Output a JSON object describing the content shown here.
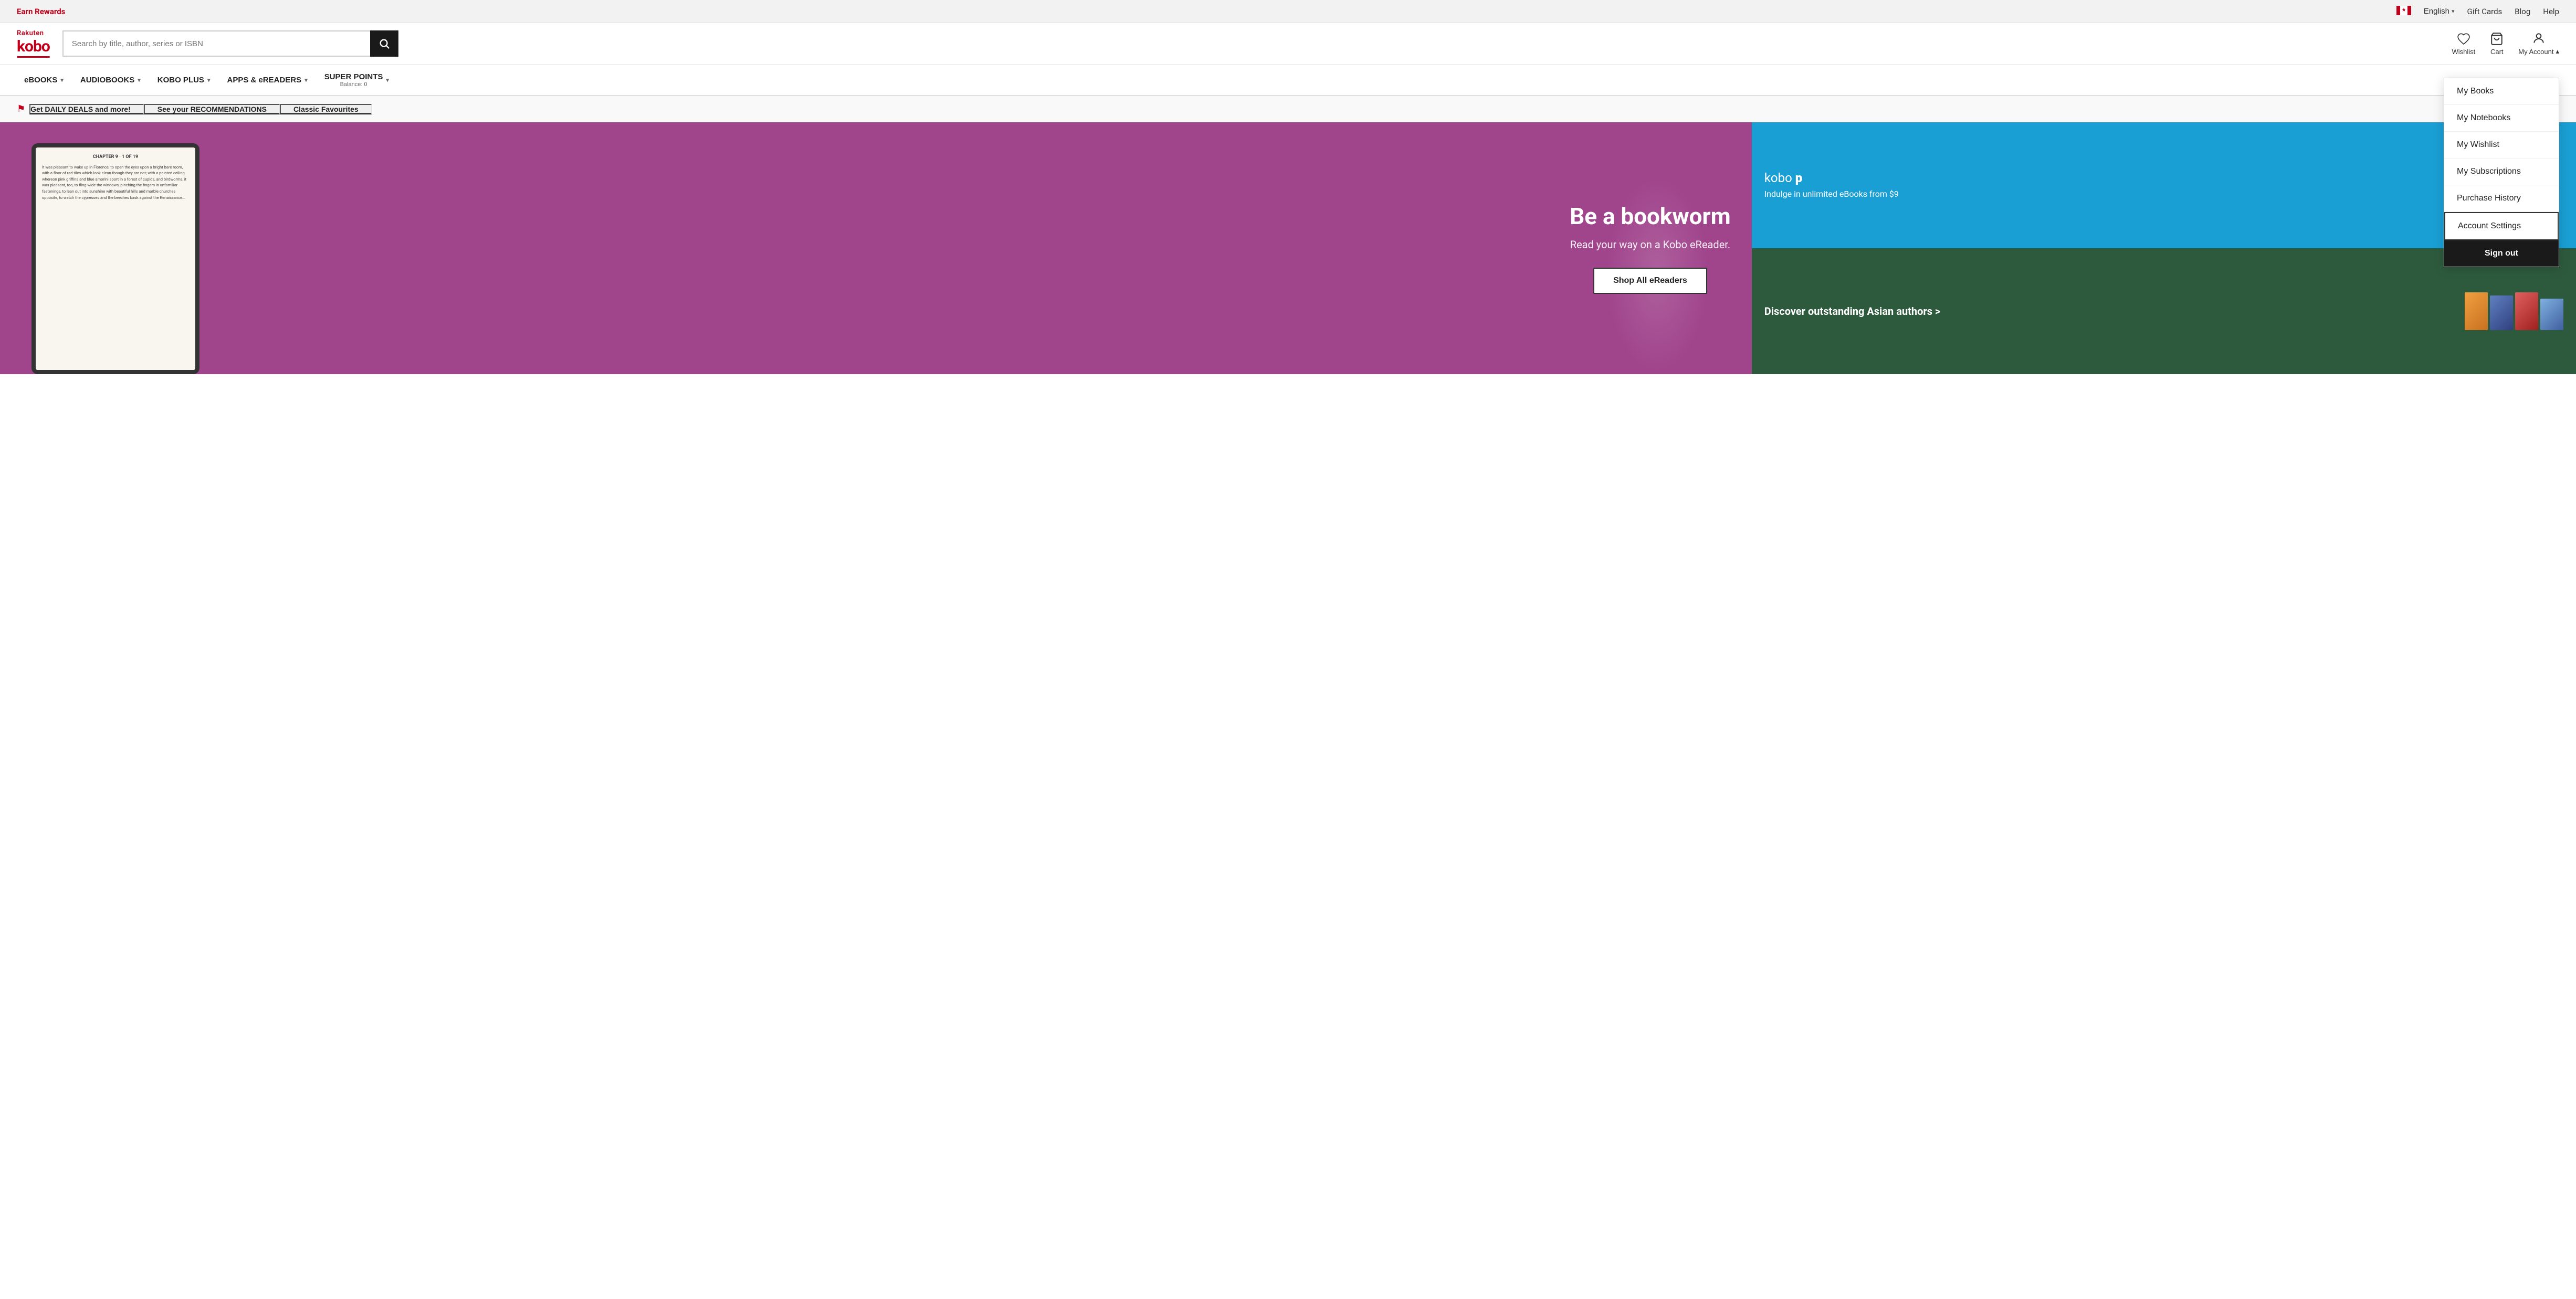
{
  "topbar": {
    "earn_rewards": "Earn Rewards",
    "language": "English",
    "gift_cards": "Gift Cards",
    "blog": "Blog",
    "help": "Help"
  },
  "header": {
    "logo_rakuten": "Rakuten",
    "logo_kobo": "kobo",
    "search_placeholder": "Search by title, author, series or ISBN",
    "wishlist_label": "Wishlist",
    "cart_label": "Cart",
    "my_account_label": "My Account"
  },
  "nav": {
    "items": [
      {
        "label": "eBOOKS",
        "has_chevron": true
      },
      {
        "label": "AUDIOBOOKS",
        "has_chevron": true
      },
      {
        "label": "KOBO PLUS",
        "has_chevron": true
      },
      {
        "label": "APPS & eREADERS",
        "has_chevron": true
      },
      {
        "label": "SUPER POINTS",
        "has_chevron": true
      }
    ],
    "balance": "Balance: 0"
  },
  "promobar": {
    "daily_deals": "Get DAILY DEALS and more!",
    "recommendations": "See your RECOMMENDATIONS",
    "classic": "Classic Favourites"
  },
  "hero": {
    "title": "Be a bookworm",
    "subtitle": "Read your way on a Kobo eReader.",
    "cta": "Shop All eReaders",
    "chapter_text": "CHAPTER 9 · 1 OF 19",
    "body_text": "It was pleasant to wake up in Florence, to open the eyes upon a bright bare room, with a floor of red tiles which look clean though they are not; with a painted ceiling whereon pink griffins and blue amorini sport in a forest of cupids, and birdworms, it was pleasant, too, to fling wide the windows, pinching the fingers in unfamiliar fastenings, to lean out into sunshine with beautiful hills and marble churches opposite, to watch the cypresses and the beeches bask against the Renaissance..."
  },
  "kobo_plus": {
    "brand": "kobo plus",
    "tagline": "Indulge in unlimited eBooks from $9"
  },
  "asian_authors": {
    "title": "Discover outstanding Asian authors >"
  },
  "dropdown": {
    "my_books": "My Books",
    "my_notebooks": "My Notebooks",
    "my_wishlist": "My Wishlist",
    "my_subscriptions": "My Subscriptions",
    "purchase_history": "Purchase History",
    "account_settings": "Account Settings",
    "sign_out": "Sign out"
  }
}
